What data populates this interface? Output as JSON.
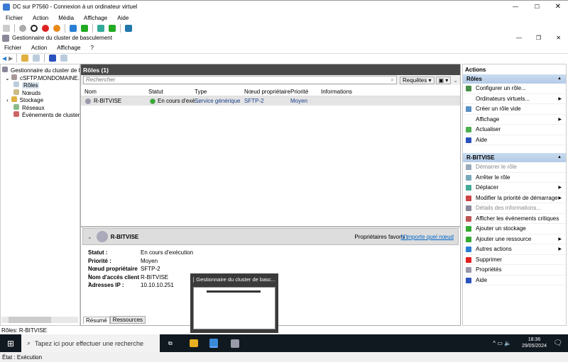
{
  "vm": {
    "title": "DC sur P7560 - Connexion à un ordinateur virtuel",
    "menu": [
      "Fichier",
      "Action",
      "Média",
      "Affichage",
      "Aide"
    ]
  },
  "app": {
    "title": "Gestionnaire du cluster de basculement",
    "menu": [
      "Fichier",
      "Action",
      "Affichage",
      "?"
    ]
  },
  "tree": {
    "root": "Gestionnaire du cluster de basc",
    "cluster": "cSFTP.MONDOMAINE.LAN",
    "items": [
      "Rôles",
      "Nœuds",
      "Stockage",
      "Réseaux",
      "Événements de cluster"
    ]
  },
  "roles": {
    "header": "Rôles (1)",
    "search_placeholder": "Rechercher",
    "queries": "Requêtes",
    "columns": [
      "Nom",
      "Statut",
      "Type",
      "Nœud propriétaire",
      "Priorité",
      "Informations"
    ],
    "rows": [
      {
        "name": "R-BITVISE",
        "status": "En cours d'exé...",
        "type": "Service générique",
        "owner": "SFTP-2",
        "priority": "Moyen",
        "info": ""
      }
    ]
  },
  "detail": {
    "name": "R-BITVISE",
    "preferred_label": "Propriétaires favoris :",
    "preferred_link": "N'importe quel nœud",
    "fields": [
      {
        "k": "Statut :",
        "v": "En cours d'exécution"
      },
      {
        "k": "Priorité :",
        "v": "Moyen"
      },
      {
        "k": "Nœud propriétaire :",
        "v": "SFTP-2"
      },
      {
        "k": "Nom d'accès client :",
        "v": "R-BITVISE"
      },
      {
        "k": "Adresses IP :",
        "v": "10.10.10.251"
      }
    ],
    "tabs": [
      "Résumé",
      "Ressources"
    ]
  },
  "actions": {
    "title": "Actions",
    "sections": [
      {
        "title": "Rôles",
        "items": [
          {
            "label": "Configurer un rôle...",
            "icon": "configure-role-icon",
            "color": "#4a8f4a"
          },
          {
            "label": "Ordinateurs virtuels...",
            "sub": true
          },
          {
            "label": "Créer un rôle vide",
            "icon": "empty-role-icon",
            "color": "#5a8fc4"
          },
          {
            "label": "Affichage",
            "sub": true
          },
          {
            "label": "Actualiser",
            "icon": "refresh-icon",
            "color": "#4caf50"
          },
          {
            "label": "Aide",
            "icon": "help-icon",
            "color": "#2a52be"
          }
        ]
      },
      {
        "title": "R-BITVISE",
        "items": [
          {
            "label": "Démarrer le rôle",
            "icon": "start-role-icon",
            "color": "#9ab",
            "disabled": true
          },
          {
            "label": "Arrêter le rôle",
            "icon": "stop-role-icon",
            "color": "#7ab"
          },
          {
            "label": "Déplacer",
            "icon": "move-icon",
            "color": "#4a9",
            "sub": true
          },
          {
            "label": "Modifier la priorité de démarrage",
            "icon": "priority-icon",
            "color": "#c44",
            "sub": true
          },
          {
            "label": "Détails des informations...",
            "icon": "info-details-icon",
            "color": "#889",
            "disabled": true
          },
          {
            "label": "Afficher les événements critiques",
            "icon": "events-icon",
            "color": "#b55"
          },
          {
            "label": "Ajouter un stockage",
            "icon": "add-storage-icon",
            "color": "#3a3"
          },
          {
            "label": "Ajouter une ressource",
            "icon": "add-resource-icon",
            "color": "#3a3",
            "sub": true
          },
          {
            "label": "Autres actions",
            "icon": "more-actions-icon",
            "color": "#2a7fd4",
            "sub": true
          },
          {
            "label": "Supprimer",
            "icon": "delete-icon",
            "color": "#e02020"
          },
          {
            "label": "Propriétés",
            "icon": "properties-icon",
            "color": "#99a"
          },
          {
            "label": "Aide",
            "icon": "help-icon",
            "color": "#2a52be"
          }
        ]
      }
    ]
  },
  "statusbar": "Rôles:  R-BITVISE",
  "taskbar": {
    "search_placeholder": "Tapez ici pour effectuer une recherche",
    "time": "18:36",
    "date": "29/05/2024",
    "notifications": "1"
  },
  "thumbnail": {
    "title": "Gestionnaire du cluster de basc..."
  },
  "vm_status": "État : Exécution"
}
